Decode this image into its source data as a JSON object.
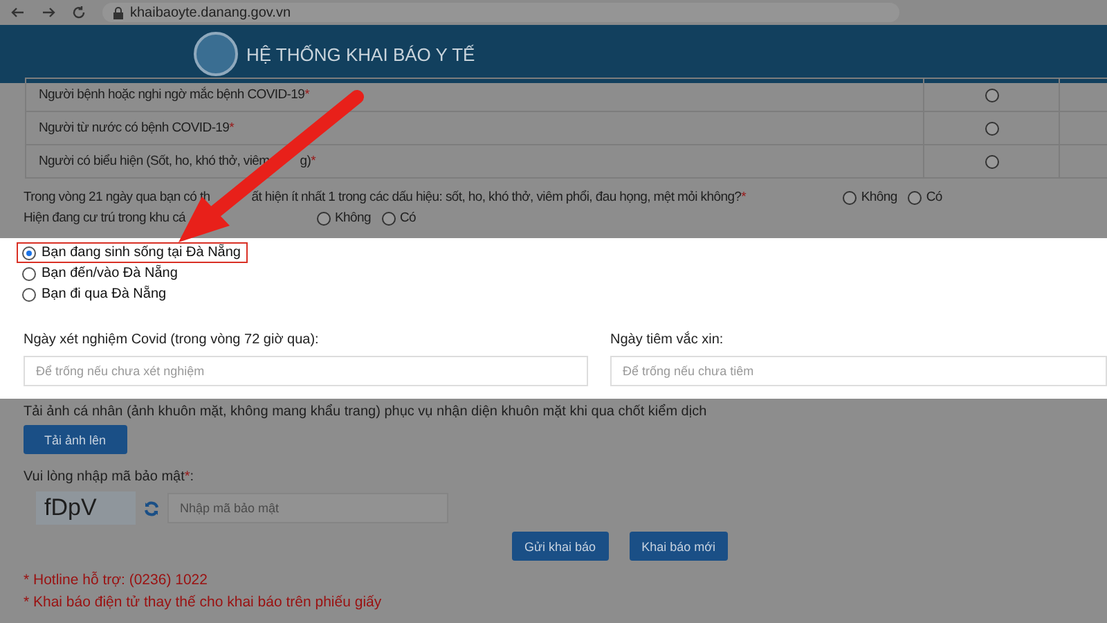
{
  "browser": {
    "url": "khaibaoyte.danang.gov.vn"
  },
  "header": {
    "title": "HỆ THỐNG KHAI BÁO Y TẾ"
  },
  "symptom_rows": [
    {
      "parts": [
        "Người bệnh hoặc nghi ngờ mắc bệnh COVID-19"
      ],
      "required_mark": "*",
      "selected": false
    },
    {
      "parts": [
        "Người từ nước có bệnh COVID-19"
      ],
      "required_mark": "*",
      "selected": false
    },
    {
      "parts": [
        "Người có biểu hiện (Sốt, ho, khó thở, viêm",
        "g)"
      ],
      "required_mark": "*",
      "selected": false
    }
  ],
  "questions": [
    {
      "parts": [
        "Trong vòng 21 ngày qua bạn có th",
        "ất hiện ít nhất 1 trong các dấu hiệu: sốt, ho, khó thở, viêm phổi, đau họng, mệt mỏi không?"
      ],
      "required_mark": "*",
      "kind": "wide",
      "options": [
        {
          "label": "Không",
          "selected": false
        },
        {
          "label": "Có",
          "selected": false
        }
      ]
    },
    {
      "parts": [
        "Hiện đang cư trú trong khu cá"
      ],
      "kind": "near",
      "options": [
        {
          "label": "Không",
          "selected": false
        },
        {
          "label": "Có",
          "selected": false
        }
      ]
    }
  ],
  "residence_options": [
    {
      "label": "Bạn đang sinh sống tại Đà Nẵng",
      "selected": true,
      "highlighted": true
    },
    {
      "label": "Bạn đến/vào Đà Nẵng",
      "selected": false,
      "highlighted": false
    },
    {
      "label": "Bạn đi qua Đà Nẵng",
      "selected": false,
      "highlighted": false
    }
  ],
  "date_fields": [
    {
      "label": "Ngày xét nghiệm Covid (trong vòng 72 giờ qua):",
      "placeholder": "Để trống nếu chưa xét nghiệm"
    },
    {
      "label": "Ngày tiêm vắc xin:",
      "placeholder": "Để trống nếu chưa tiêm"
    }
  ],
  "photo": {
    "instruction": "Tải ảnh cá nhân (ảnh khuôn mặt, không mang khẩu trang) phục vụ nhận diện khuôn mặt khi qua chốt kiểm dịch",
    "button": "Tải ảnh lên"
  },
  "captcha": {
    "label": "Vui lòng nhập mã bảo mật",
    "required_mark": "*",
    "suffix": ":",
    "code": "fDpV",
    "placeholder": "Nhập mã bảo mật"
  },
  "actions": [
    "Gửi khai báo",
    "Khai báo mới"
  ],
  "notes": [
    "* Hotline hỗ trợ: (0236) 1022",
    "* Khai báo điện tử thay thế cho khai báo trên phiếu giấy"
  ]
}
